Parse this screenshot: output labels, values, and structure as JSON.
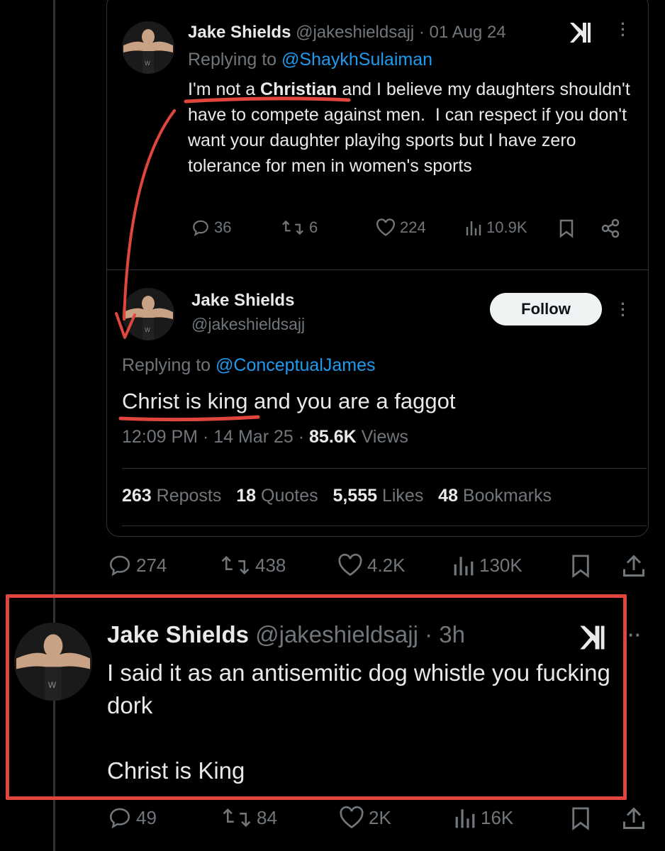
{
  "tweet1": {
    "name": "Jake Shields",
    "handle": "@jakeshieldsajj",
    "time": "· 01 Aug 24",
    "replying_prefix": "Replying to ",
    "replying_to": "@ShaykhSulaiman",
    "text_prefix": "I'm not a ",
    "text_bold": "Christian",
    "text_rest": " and I believe my daughters shouldn't have to compete against men.  I can respect if you don't want your daughter playihg sports but I have zero tolerance for men in women's sports",
    "actions": {
      "replies": "36",
      "reposts": "6",
      "likes": "224",
      "views": "10.9K"
    }
  },
  "tweet2": {
    "name": "Jake Shields",
    "handle": "@jakeshieldsajj",
    "follow_label": "Follow",
    "replying_prefix": "Replying to ",
    "replying_to": "@ConceptualJames",
    "text": "Christ is king and you are a faggot",
    "timestamp": "12:09 PM · 14 Mar 25 · ",
    "views_count": "85.6K",
    "views_label": " Views",
    "stats": {
      "reposts_count": "263",
      "reposts_label": " Reposts",
      "quotes_count": "18",
      "quotes_label": " Quotes",
      "likes_count": "5,555",
      "likes_label": " Likes",
      "bookmarks_count": "48",
      "bookmarks_label": " Bookmarks"
    }
  },
  "quote_actions": {
    "replies": "274",
    "reposts": "438",
    "likes": "4.2K",
    "views": "130K"
  },
  "tweet3": {
    "name": "Jake Shields",
    "handle": "@jakeshieldsajj",
    "time": "· 3h",
    "text": "I said it as an antisemitic dog whistle you fucking dork\n\nChrist is King",
    "actions": {
      "replies": "49",
      "reposts": "84",
      "likes": "2K",
      "views": "16K"
    }
  },
  "colors": {
    "annotation": "#e0463e",
    "link": "#1d9bf0",
    "muted": "#71767b"
  }
}
